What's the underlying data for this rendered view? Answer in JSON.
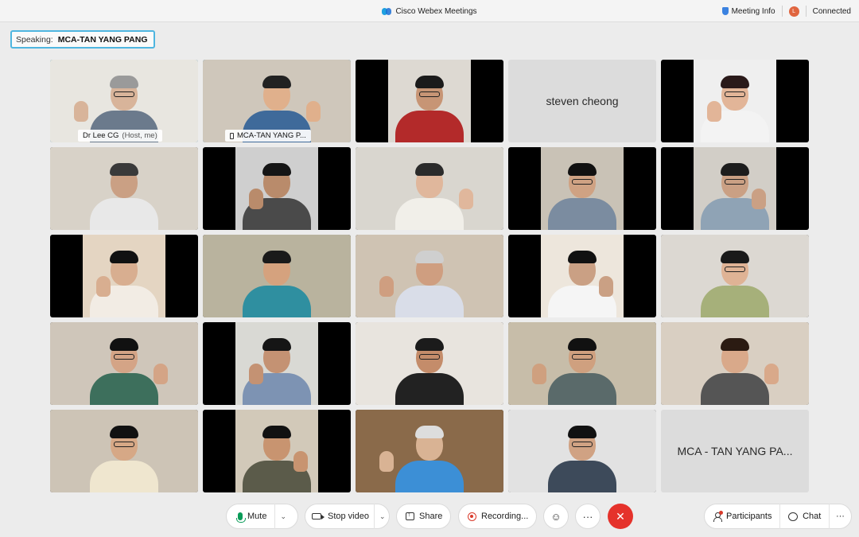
{
  "window": {
    "title": "Cisco Webex Meetings",
    "meeting_info_label": "Meeting Info",
    "avatar_letter": "L",
    "connection_status": "Connected"
  },
  "speaking": {
    "label": "Speaking:",
    "name": "MCA-TAN YANG PANG"
  },
  "tiles": [
    {
      "label": "Dr Lee CG",
      "sub": "(Host, me)",
      "kind": "video",
      "bg": "#e8e6e0",
      "shirt": "#6b7a8c",
      "skin": "#d8b49a",
      "hair": "#9a9a9a",
      "glasses": true
    },
    {
      "label": "MCA-TAN YANG P...",
      "kind": "video",
      "phone": true,
      "bg": "#cfc7bb",
      "shirt": "#3f6a9a",
      "skin": "#e0b08c",
      "hair": "#222"
    },
    {
      "kind": "video",
      "bg": "#ddd9d2",
      "shirt": "#b32a2a",
      "skin": "#c79575",
      "hair": "#1b1b1b",
      "glasses": true
    },
    {
      "kind": "text",
      "name": "steven cheong"
    },
    {
      "kind": "video",
      "bg": "#efefef",
      "shirt": "#f3f3f3",
      "skin": "#e2b598",
      "hair": "#2a1a1a",
      "glasses": true
    },
    {
      "kind": "video",
      "bg": "#d8d2c8",
      "shirt": "#e8e8e8",
      "skin": "#caa084",
      "hair": "#3a3a3a"
    },
    {
      "kind": "video",
      "bg": "#cfcfcf",
      "shirt": "#4a4a4a",
      "skin": "#b98b6b",
      "hair": "#151515"
    },
    {
      "kind": "video",
      "bg": "#d9d6cf",
      "shirt": "#f1efe9",
      "skin": "#e0b79c",
      "hair": "#2b2b2b"
    },
    {
      "kind": "video",
      "bg": "#c9c2b6",
      "shirt": "#7b8ca0",
      "skin": "#cfa283",
      "hair": "#111",
      "glasses": true
    },
    {
      "kind": "video",
      "bg": "#d2cec7",
      "shirt": "#8fa3b5",
      "skin": "#caa084",
      "hair": "#1d1d1d",
      "glasses": true
    },
    {
      "kind": "video",
      "bg": "#e4d5c2",
      "shirt": "#f2ece4",
      "skin": "#d8ae90",
      "hair": "#111"
    },
    {
      "kind": "video",
      "bg": "#b9b39e",
      "shirt": "#2f8fa0",
      "skin": "#d5a27e",
      "hair": "#1a1a1a"
    },
    {
      "kind": "video",
      "bg": "#cfc3b3",
      "shirt": "#d9dde8",
      "skin": "#cf9e80",
      "hair": "#cfcfcf"
    },
    {
      "kind": "video",
      "bg": "#ede6dc",
      "shirt": "#f5f5f5",
      "skin": "#caa084",
      "hair": "#111"
    },
    {
      "kind": "video",
      "bg": "#dcd8d2",
      "shirt": "#a6b07a",
      "skin": "#dfb395",
      "hair": "#1a1a1a",
      "glasses": true
    },
    {
      "kind": "video",
      "bg": "#cfc6ba",
      "shirt": "#3d6f5c",
      "skin": "#d4a486",
      "hair": "#111",
      "glasses": true
    },
    {
      "kind": "video",
      "bg": "#d9d9d4",
      "shirt": "#7d93b3",
      "skin": "#c49273",
      "hair": "#151515"
    },
    {
      "kind": "video",
      "bg": "#e8e4de",
      "shirt": "#222",
      "skin": "#c48c6a",
      "hair": "#1b1b1b",
      "glasses": true
    },
    {
      "kind": "video",
      "bg": "#c7bda9",
      "shirt": "#5a6a6a",
      "skin": "#cfa07f",
      "hair": "#111",
      "glasses": true
    },
    {
      "kind": "video",
      "bg": "#d9cfc2",
      "shirt": "#555",
      "skin": "#d9a98a",
      "hair": "#2b1b12"
    },
    {
      "kind": "video",
      "bg": "#cdc4b6",
      "shirt": "#efe6cf",
      "skin": "#d6a886",
      "hair": "#111",
      "glasses": true
    },
    {
      "kind": "video",
      "bg": "#d2c9b9",
      "shirt": "#5b5b4a",
      "skin": "#c89470",
      "hair": "#111"
    },
    {
      "kind": "video",
      "bg": "#8a6a4a",
      "shirt": "#3c8fd6",
      "skin": "#d9b394",
      "hair": "#ddd"
    },
    {
      "kind": "video",
      "bg": "#e2e2e2",
      "shirt": "#3d4a5a",
      "skin": "#d0a283",
      "hair": "#111",
      "glasses": true
    },
    {
      "kind": "text",
      "name": "MCA - TAN YANG PA..."
    }
  ],
  "toolbar": {
    "mute_label": "Mute",
    "stop_video_label": "Stop video",
    "share_label": "Share",
    "recording_label": "Recording...",
    "more_label": "···",
    "participants_label": "Participants",
    "chat_label": "Chat"
  },
  "colors": {
    "accent": "#4fb6e0",
    "end_call": "#e5322b",
    "mic_on": "#0a9b58",
    "recording": "#d93a2b"
  }
}
